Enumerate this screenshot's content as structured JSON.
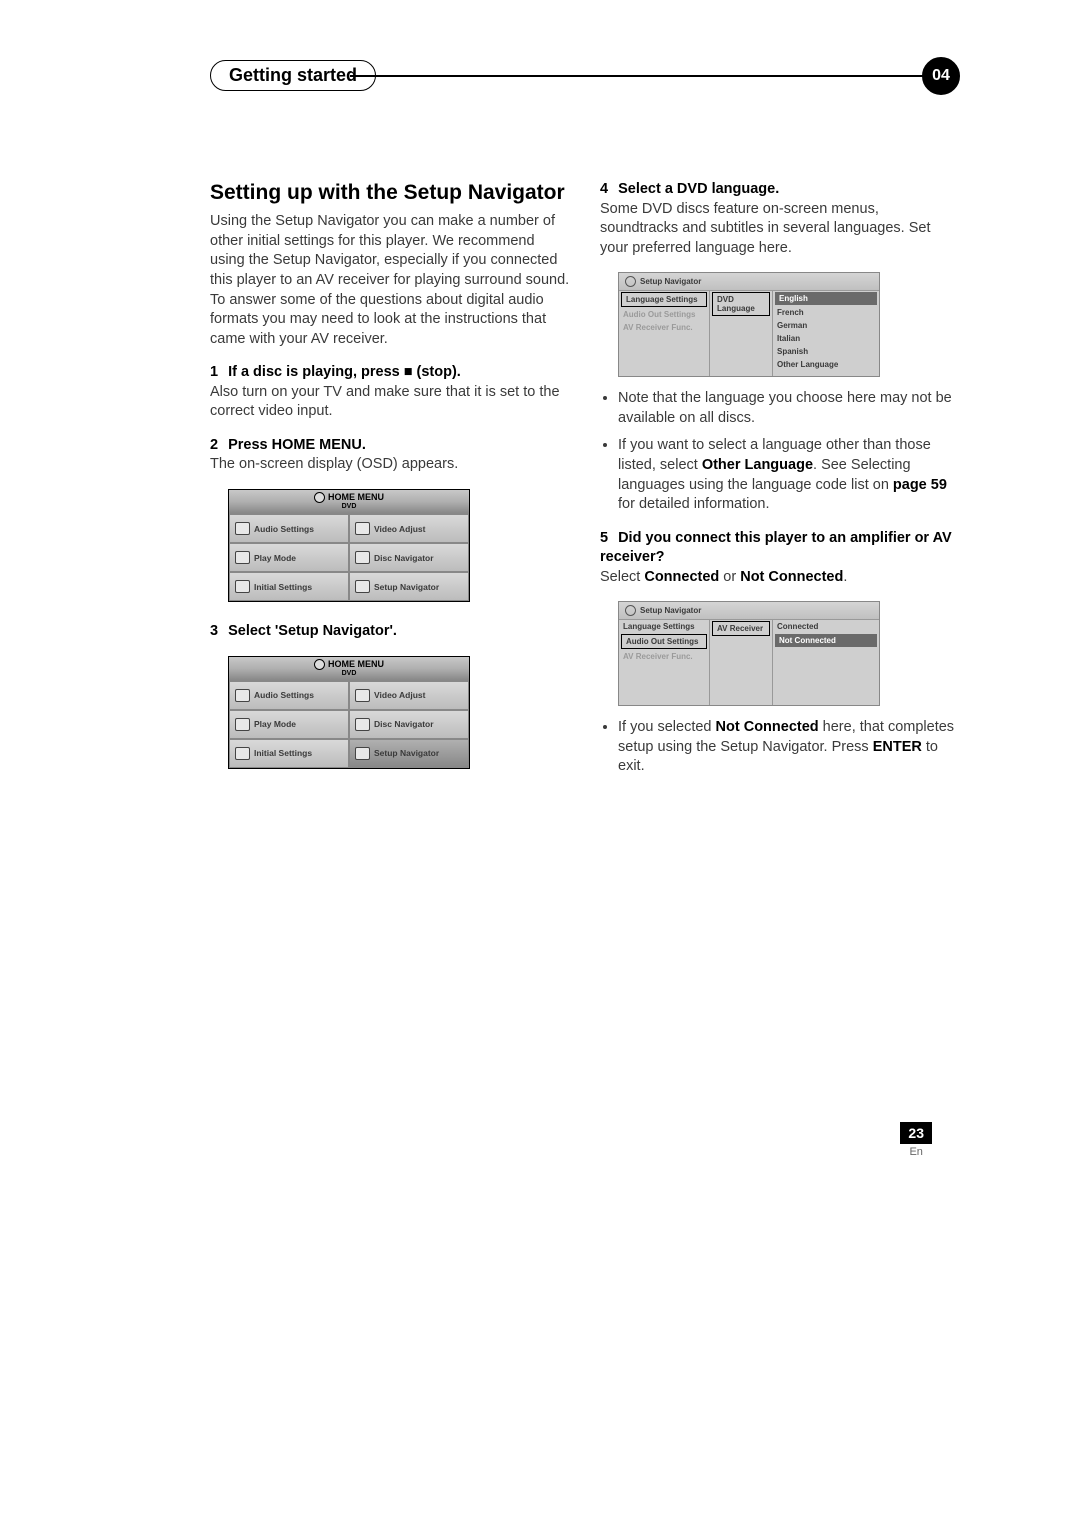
{
  "header": {
    "title": "Getting started",
    "chapter": "04"
  },
  "section_title": "Setting up with the Setup Navigator",
  "intro": "Using the Setup Navigator you can make a number of other initial settings for this player. We recommend using the Setup Navigator, especially if you connected this player to an AV receiver for playing surround sound. To answer some of the questions about digital audio formats you may need to look at the instructions that came with your AV receiver.",
  "step1": {
    "num": "1",
    "title": "If a disc is playing, press ■ (stop).",
    "text": "Also turn on your TV and make sure that it is set to the correct video input."
  },
  "step2": {
    "num": "2",
    "title": "Press HOME MENU.",
    "text": "The on-screen display (OSD) appears."
  },
  "step3": {
    "num": "3",
    "title": "Select 'Setup Navigator'."
  },
  "step4": {
    "num": "4",
    "title": "Select a DVD language.",
    "text": "Some DVD discs feature on-screen menus, soundtracks and subtitles in several languages. Set your preferred language here."
  },
  "bullets4": [
    "Note that the language you choose here may not be available on all discs.",
    "If you want to select a language other than those listed, select <b>Other Language</b>. See Selecting languages using the language code list on <b>page 59</b> for detailed information."
  ],
  "step5": {
    "num": "5",
    "title": "Did you connect this player to an amplifier or AV receiver?",
    "text_pre": "Select ",
    "opt1": "Connected",
    "mid": " or ",
    "opt2": "Not Connected",
    "tail": "."
  },
  "bullets5": [
    "If you selected <b>Not Connected</b> here, that completes setup using the Setup Navigator. Press <b>ENTER</b> to exit."
  ],
  "osd": {
    "title": "HOME MENU",
    "sub": "DVD",
    "cells": [
      "Audio Settings",
      "Video Adjust",
      "Play Mode",
      "Disc Navigator",
      "Initial Settings",
      "Setup Navigator"
    ]
  },
  "nav1": {
    "title": "Setup Navigator",
    "left": [
      "Language Settings",
      "Audio Out Settings",
      "AV Receiver Func."
    ],
    "mid": "DVD Language",
    "right": [
      "English",
      "French",
      "German",
      "Italian",
      "Spanish",
      "Other Language"
    ]
  },
  "nav2": {
    "title": "Setup Navigator",
    "left": [
      "Language Settings",
      "Audio Out Settings",
      "AV Receiver Func."
    ],
    "mid": "AV Receiver",
    "right": [
      "Connected",
      "Not Connected"
    ]
  },
  "footer": {
    "page": "23",
    "lang": "En"
  }
}
